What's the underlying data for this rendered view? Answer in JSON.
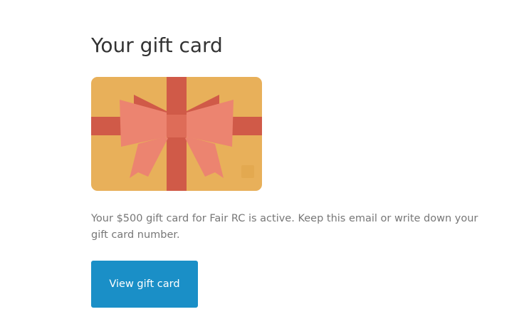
{
  "email": {
    "title": "Your gift card",
    "message": "Your $500 gift card for Fair RC is active. Keep this email or write down your gift card number.",
    "cta_label": "View gift card"
  },
  "gift_card_image": {
    "icon": "gift-card-bow-icon",
    "colors": {
      "card": "#E8B05A",
      "ribbon": "#D05A48",
      "bow": "#EC8470",
      "accent": "#1A8FC7"
    }
  }
}
